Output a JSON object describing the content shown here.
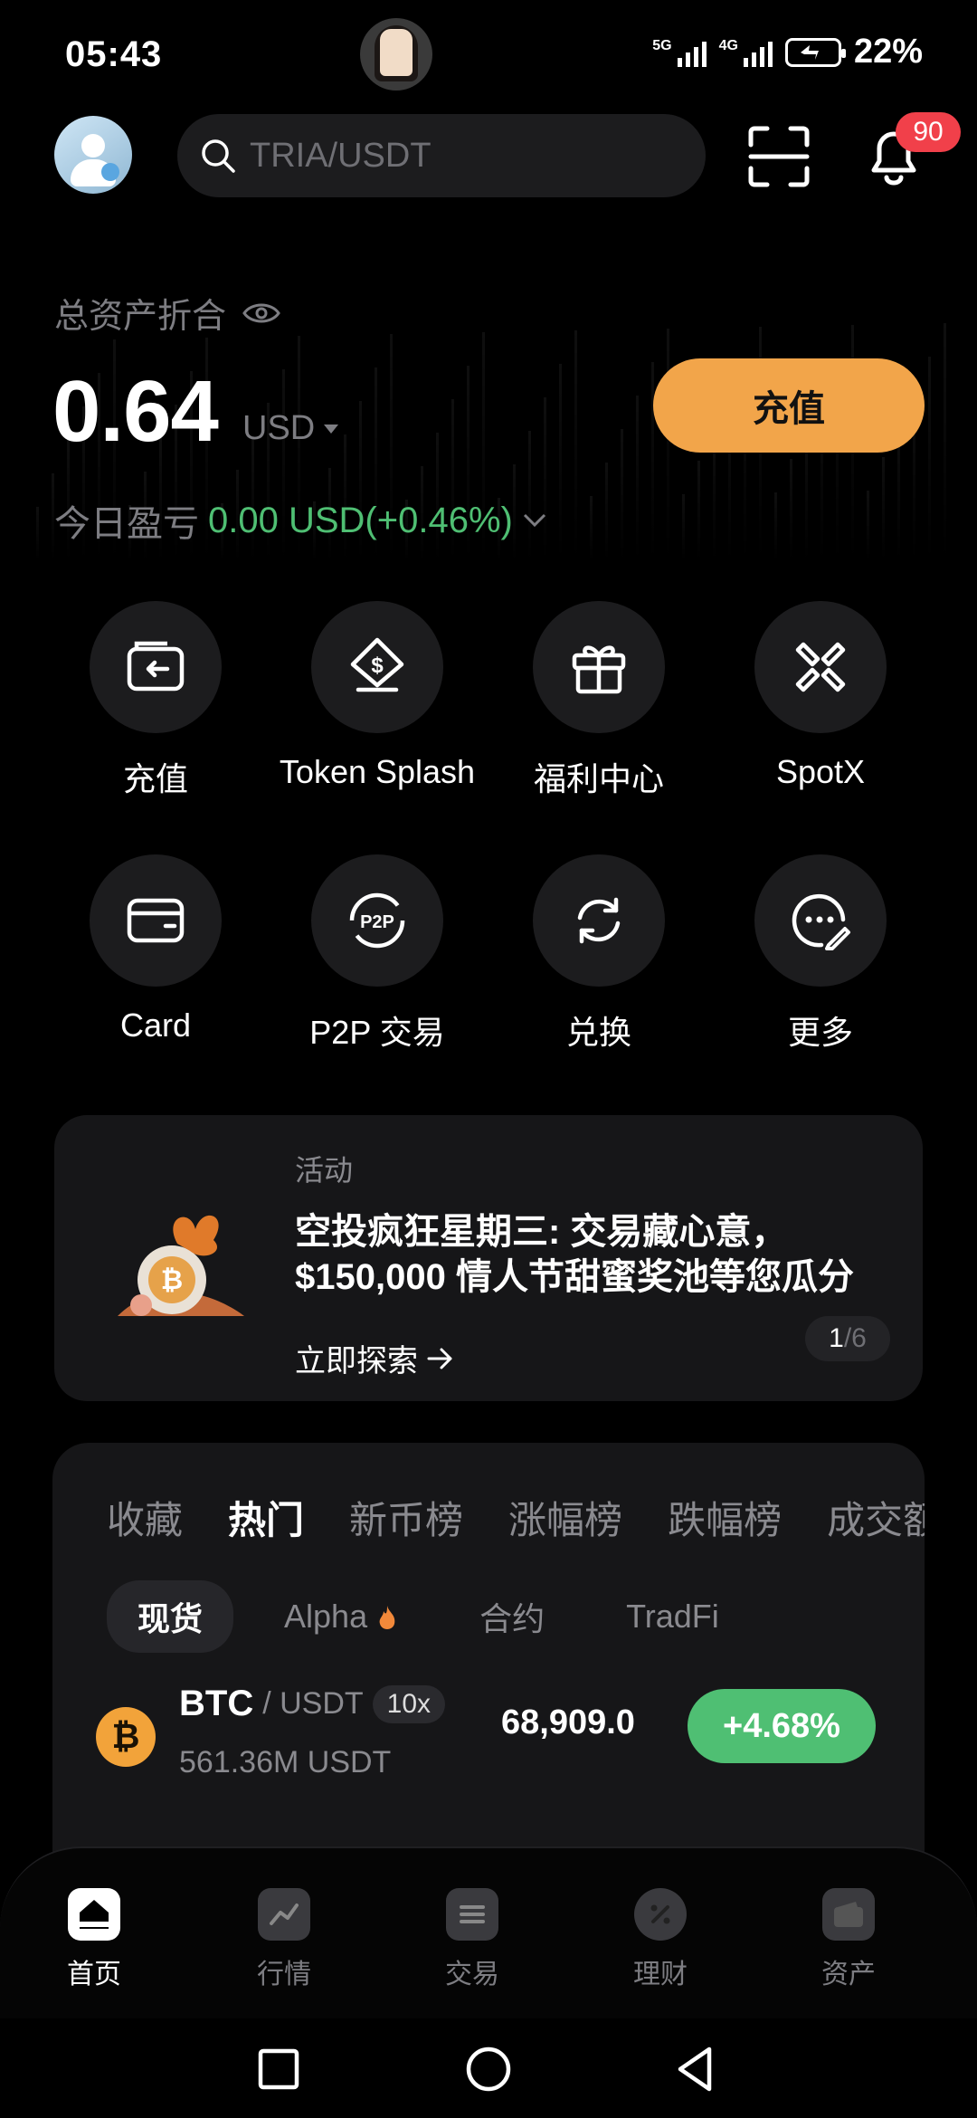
{
  "status_bar": {
    "time": "05:43",
    "network_1": "5G",
    "network_2": "4G",
    "battery": "22%"
  },
  "header": {
    "search_placeholder": "TRIA/USDT",
    "notification_count": "90"
  },
  "assets": {
    "label": "总资产折合",
    "value": "0.64",
    "unit": "USD",
    "pnl_label": "今日盈亏",
    "pnl_value": "0.00 USD(+0.46%)",
    "deposit_button": "充值"
  },
  "quick_actions": [
    {
      "label": "充值",
      "icon": "deposit-icon"
    },
    {
      "label": "Token Splash",
      "icon": "token-splash-icon"
    },
    {
      "label": "福利中心",
      "icon": "gift-icon"
    },
    {
      "label": "SpotX",
      "icon": "spotx-icon"
    },
    {
      "label": "Card",
      "icon": "card-icon"
    },
    {
      "label": "P2P 交易",
      "icon": "p2p-icon"
    },
    {
      "label": "兑换",
      "icon": "convert-icon"
    },
    {
      "label": "更多",
      "icon": "more-icon"
    }
  ],
  "promo": {
    "tag": "活动",
    "title_line1": "空投疯狂星期三: 交易藏心意，",
    "title_line2": "$150,000 情人节甜蜜奖池等您瓜分",
    "link": "立即探索",
    "page_current": "1",
    "page_total": "/6"
  },
  "markets": {
    "tabs": [
      "收藏",
      "热门",
      "新币榜",
      "涨幅榜",
      "跌幅榜",
      "成交额"
    ],
    "active_tab": "热门",
    "subtabs": [
      "现货",
      "Alpha",
      "合约",
      "TradFi"
    ],
    "active_subtab": "现货",
    "rows": [
      {
        "base": "BTC",
        "quote": "/ USDT",
        "leverage": "10x",
        "volume": "561.36M USDT",
        "price": "68,909.0",
        "change": "+4.68%"
      }
    ]
  },
  "bottom_nav": [
    {
      "label": "首页",
      "icon": "home-icon"
    },
    {
      "label": "行情",
      "icon": "chart-icon"
    },
    {
      "label": "交易",
      "icon": "trade-icon"
    },
    {
      "label": "理财",
      "icon": "earn-icon"
    },
    {
      "label": "资产",
      "icon": "wallet-icon"
    }
  ],
  "colors": {
    "accent": "#f2a54a",
    "positive": "#4fbf73",
    "badge": "#f1404a",
    "card_bg": "#161618"
  }
}
